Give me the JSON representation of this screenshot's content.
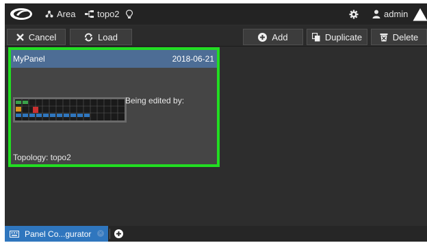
{
  "topbar": {
    "area_label": "Area",
    "topology_label": "topo2",
    "user_label": "admin"
  },
  "toolbar": {
    "cancel_label": "Cancel",
    "load_label": "Load",
    "add_label": "Add",
    "duplicate_label": "Duplicate",
    "delete_label": "Delete"
  },
  "panel": {
    "name": "MyPanel",
    "date": "2018-06-21",
    "edited_by_label": "Being edited by:",
    "topology_label": "Topology:",
    "topology_value": "topo2",
    "selected_color": "#22dd22"
  },
  "tabs": {
    "active_label": "Panel Co...gurator"
  },
  "colors": {
    "accent_blue": "#2f76be",
    "header_blue": "#4d6d95"
  }
}
